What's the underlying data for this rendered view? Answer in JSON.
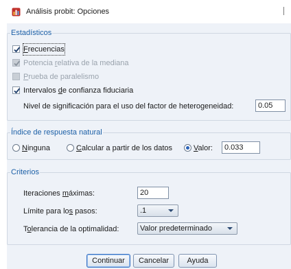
{
  "window": {
    "title": "Análisis probit: Opciones",
    "app_icon": "spss-icon"
  },
  "estadisticos": {
    "legend": "Estadísticos",
    "frecuencias": {
      "pre": "",
      "u": "F",
      "post": "recuencias",
      "checked": true,
      "enabled": true
    },
    "potencia": {
      "pre": "Potencia ",
      "u": "r",
      "post": "elativa de la mediana",
      "checked": true,
      "enabled": false
    },
    "paralelismo": {
      "pre": "",
      "u": "P",
      "post": "rueba de paralelismo",
      "checked": false,
      "enabled": false
    },
    "intervalos": {
      "pre": "Intervalos ",
      "u": "d",
      "post": "e confianza fiduciaria",
      "checked": true,
      "enabled": true
    },
    "nivel_label": "Nivel de significación para el uso del factor de heterogeneidad:",
    "nivel_value": "0.05"
  },
  "indice": {
    "legend": "Índice de respuesta natural",
    "ninguna": {
      "pre": "",
      "u": "N",
      "post": "inguna"
    },
    "calcular": {
      "pre": "",
      "u": "C",
      "post": "alcular a partir de los datos"
    },
    "valor": {
      "pre": "",
      "u": "V",
      "post": "alor:"
    },
    "selected": "valor",
    "valor_value": "0.033"
  },
  "criterios": {
    "legend": "Criterios",
    "iteraciones": {
      "pre": "Iteraciones ",
      "u": "m",
      "post": "áximas:"
    },
    "iteraciones_value": "20",
    "limite": {
      "pre": "Límite para lo",
      "u": "s",
      "post": " pasos:"
    },
    "limite_value": ".1",
    "tolerancia": {
      "pre": "T",
      "u": "o",
      "post": "lerancia de la optimalidad:"
    },
    "tolerancia_value": "Valor predeterminado"
  },
  "buttons": {
    "continuar": "Continuar",
    "cancelar": "Cancelar",
    "ayuda": "Ayuda"
  }
}
